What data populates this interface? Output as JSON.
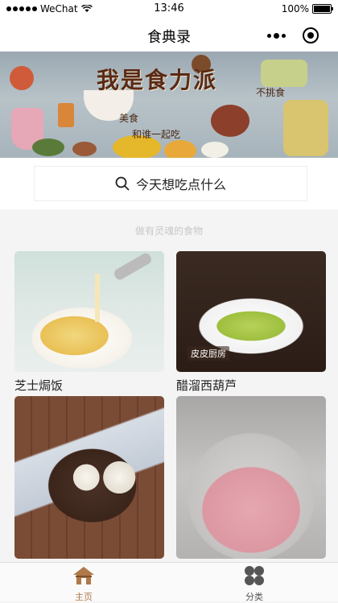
{
  "status_bar": {
    "carrier": "WeChat",
    "time": "13:46",
    "battery": "100%"
  },
  "nav": {
    "title": "食典录"
  },
  "banner": {
    "title": "我是食力派",
    "tag_right": "不挑食",
    "tag_left": "美食",
    "tag_bottom": "和谁一起吃"
  },
  "search": {
    "placeholder": "今天想吃点什么"
  },
  "subtitle": "做有灵魂的食物",
  "recipes": [
    {
      "name": "芝士焗饭"
    },
    {
      "name": "醋溜西葫芦",
      "watermark": "皮皮厨房"
    },
    {
      "name": ""
    },
    {
      "name": ""
    }
  ],
  "tabs": [
    {
      "label": "主页",
      "icon": "home-icon",
      "active": true,
      "color": "#b0794a"
    },
    {
      "label": "分类",
      "icon": "category-icon",
      "active": false,
      "color": "#555555"
    }
  ]
}
